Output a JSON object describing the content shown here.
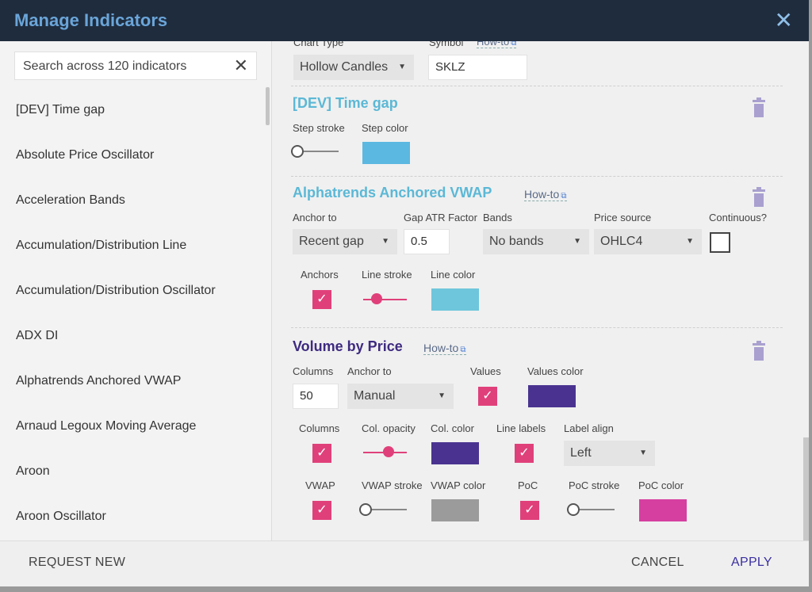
{
  "dialog": {
    "title": "Manage Indicators"
  },
  "search": {
    "placeholder": "Search across 120 indicators"
  },
  "indicators": [
    "[DEV] Time gap",
    "Absolute Price Oscillator",
    "Acceleration Bands",
    "Accumulation/Distribution Line",
    "Accumulation/Distribution Oscillator",
    "ADX DI",
    "Alphatrends Anchored VWAP",
    "Arnaud Legoux Moving Average",
    "Aroon",
    "Aroon Oscillator"
  ],
  "chart": {
    "type_label": "Chart Type",
    "type_value": "Hollow Candles",
    "symbol_label": "Symbol",
    "symbol_howto": "How-to",
    "symbol_value": "SKLZ"
  },
  "timegap": {
    "title": "[DEV] Time gap",
    "title_color": "#5bb8d6",
    "step_stroke_label": "Step stroke",
    "step_color_label": "Step color",
    "step_stroke": 0,
    "step_color": "#5bb8e0"
  },
  "vwap": {
    "title": "Alphatrends Anchored VWAP",
    "title_color": "#5bb8d6",
    "howto": "How-to",
    "anchor_label": "Anchor to",
    "anchor_value": "Recent gap",
    "gap_label": "Gap ATR Factor",
    "gap_value": "0.5",
    "bands_label": "Bands",
    "bands_value": "No bands",
    "price_label": "Price source",
    "price_value": "OHLC4",
    "continuous_label": "Continuous?",
    "continuous": false,
    "anchors_label": "Anchors",
    "anchors": true,
    "line_stroke_label": "Line stroke",
    "line_stroke": 0.25,
    "line_color_label": "Line color",
    "line_color": "#6ec6dc"
  },
  "vbp": {
    "title": "Volume by Price",
    "title_color": "#3e2a80",
    "howto": "How-to",
    "columns_label": "Columns",
    "columns_value": "50",
    "anchor_label": "Anchor to",
    "anchor_value": "Manual",
    "values_label": "Values",
    "values": true,
    "values_color_label": "Values color",
    "values_color": "#4a3390",
    "columns_check_label": "Columns",
    "columns_check": true,
    "col_opacity_label": "Col. opacity",
    "col_opacity": 0.6,
    "col_color_label": "Col. color",
    "col_color": "#4a3390",
    "line_labels_label": "Line labels",
    "line_labels": true,
    "label_align_label": "Label align",
    "label_align_value": "Left",
    "vwap_label": "VWAP",
    "vwap": true,
    "vwap_stroke_label": "VWAP stroke",
    "vwap_stroke": 0,
    "vwap_color_label": "VWAP color",
    "vwap_color": "#9b9b9b",
    "poc_label": "PoC",
    "poc": true,
    "poc_stroke_label": "PoC stroke",
    "poc_stroke": 0,
    "poc_color_label": "PoC color",
    "poc_color": "#d63fa0"
  },
  "footer": {
    "request_new": "REQUEST NEW",
    "cancel": "CANCEL",
    "apply": "APPLY",
    "apply_color": "#3a2fa0"
  },
  "icons": {
    "close": "close-icon",
    "clear": "clear-search-icon",
    "caret": "caret-down-icon",
    "trash": "trash-icon",
    "external": "external-link-icon"
  }
}
